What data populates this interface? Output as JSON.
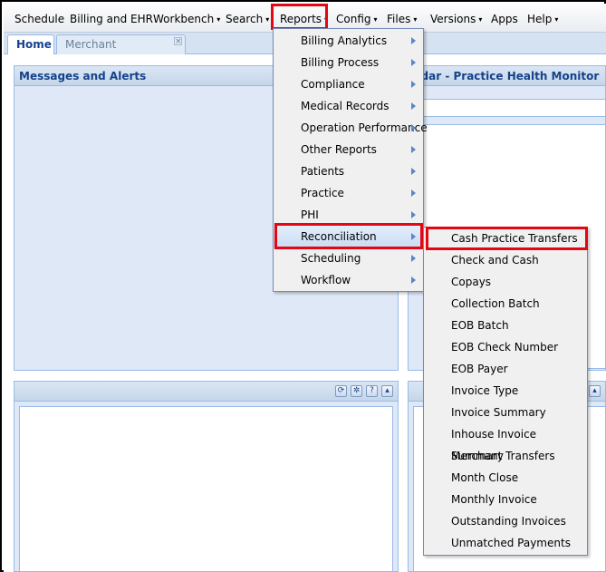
{
  "menubar": {
    "items": [
      {
        "label": "Schedule",
        "caret": false
      },
      {
        "label": "Billing and EHR",
        "caret": false
      },
      {
        "label": "Workbench",
        "caret": true
      },
      {
        "label": "Search",
        "caret": true
      },
      {
        "label": "Reports",
        "caret": true
      },
      {
        "label": "Config",
        "caret": true
      },
      {
        "label": "Files",
        "caret": true
      },
      {
        "label": "Versions",
        "caret": true
      },
      {
        "label": "Apps",
        "caret": false
      },
      {
        "label": "Help",
        "caret": true
      }
    ],
    "caret_glyph": "▾"
  },
  "tabs": [
    {
      "label": "Home"
    },
    {
      "label": "Merchant Configuration"
    }
  ],
  "panels": {
    "messages_title": "Messages and Alerts",
    "calendar_title": "ndar - Practice Health Monitor"
  },
  "reports_menu": {
    "items": [
      "Billing Analytics",
      "Billing Process",
      "Compliance",
      "Medical Records",
      "Operation Performance",
      "Other Reports",
      "Patients",
      "Practice",
      "PHI",
      "Reconciliation",
      "Scheduling",
      "Workflow"
    ],
    "active_item": "Reconciliation"
  },
  "reconciliation_submenu": {
    "items": [
      "Cash Practice Transfers",
      "Check and Cash",
      "Copays",
      "Collection Batch",
      "EOB Batch",
      "EOB Check Number",
      "EOB Payer",
      "Invoice Type",
      "Invoice Summary",
      "Inhouse Invoice Summary",
      "Merchant Transfers",
      "Month Close",
      "Monthly Invoice",
      "Outstanding Invoices",
      "Unmatched Payments"
    ],
    "highlighted_item": "Cash Practice Transfers"
  },
  "colors": {
    "highlight_red": "#e30613",
    "panel_title": "#15428b",
    "panel_border": "#99bbe8"
  }
}
